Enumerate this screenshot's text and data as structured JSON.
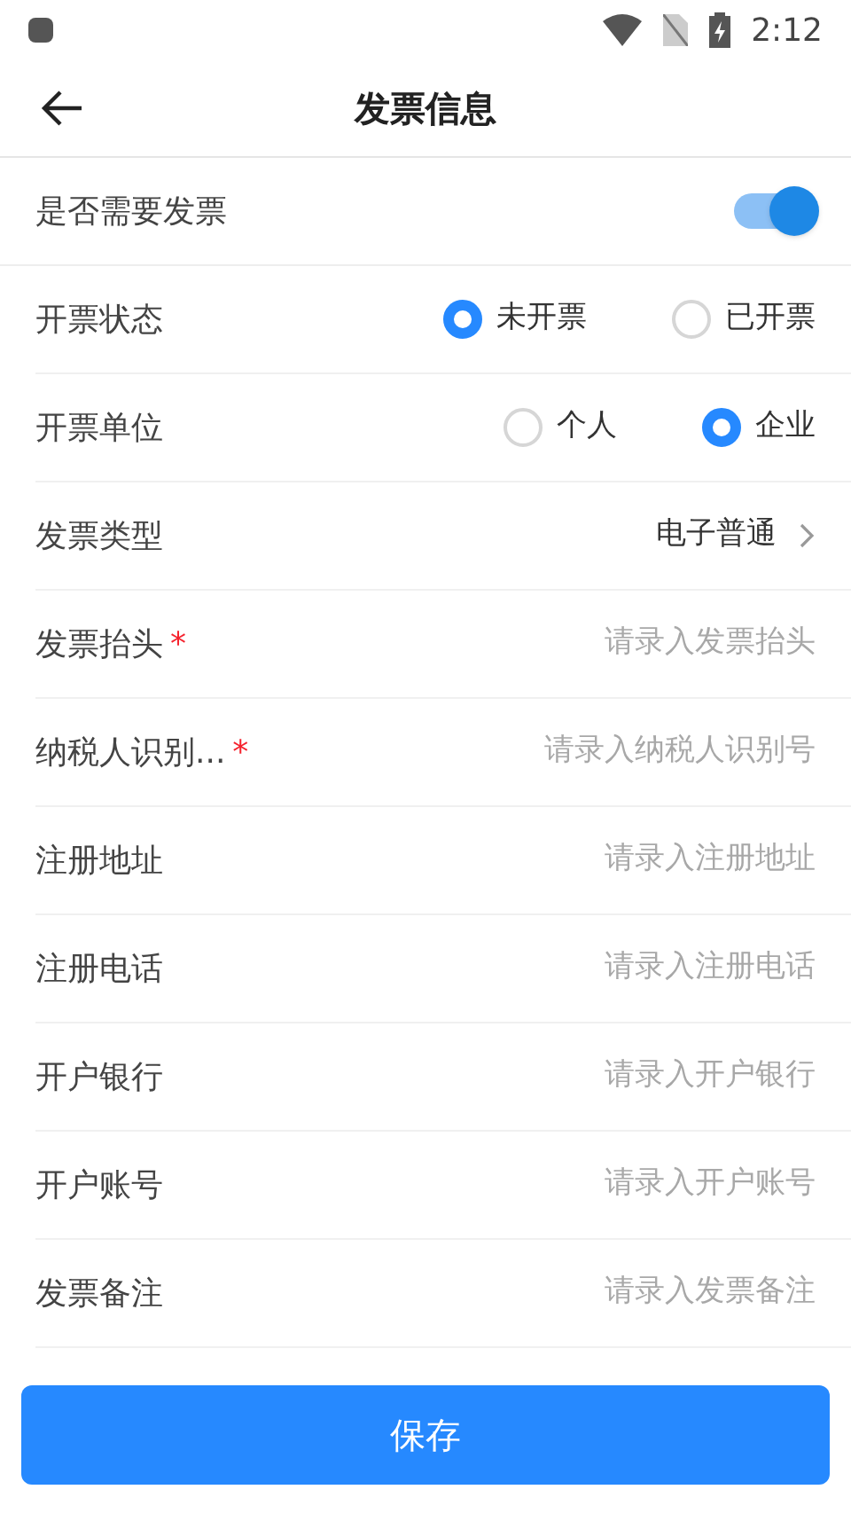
{
  "status_bar": {
    "time": "2:12"
  },
  "header": {
    "title": "发票信息"
  },
  "fields": [
    {
      "kind": "toggle",
      "label": "是否需要发票",
      "on": true
    },
    {
      "kind": "radio",
      "label": "开票状态",
      "options": [
        {
          "label": "未开票",
          "selected": true
        },
        {
          "label": "已开票",
          "selected": false
        }
      ]
    },
    {
      "kind": "radio",
      "label": "开票单位",
      "options": [
        {
          "label": "个人",
          "selected": false
        },
        {
          "label": "企业",
          "selected": true
        }
      ]
    },
    {
      "kind": "select",
      "label": "发票类型",
      "value": "电子普通"
    },
    {
      "kind": "input",
      "label": "发票抬头",
      "required_mark": "*",
      "placeholder": "请录入发票抬头"
    },
    {
      "kind": "input",
      "label": "纳税人识别...",
      "required_mark": "*",
      "placeholder": "请录入纳税人识别号"
    },
    {
      "kind": "input",
      "label": "注册地址",
      "placeholder": "请录入注册地址"
    },
    {
      "kind": "input",
      "label": "注册电话",
      "placeholder": "请录入注册电话"
    },
    {
      "kind": "input",
      "label": "开户银行",
      "placeholder": "请录入开户银行"
    },
    {
      "kind": "input",
      "label": "开户账号",
      "placeholder": "请录入开户账号"
    },
    {
      "kind": "input",
      "label": "发票备注",
      "placeholder": "请录入发票备注"
    }
  ],
  "save_button": "保存"
}
